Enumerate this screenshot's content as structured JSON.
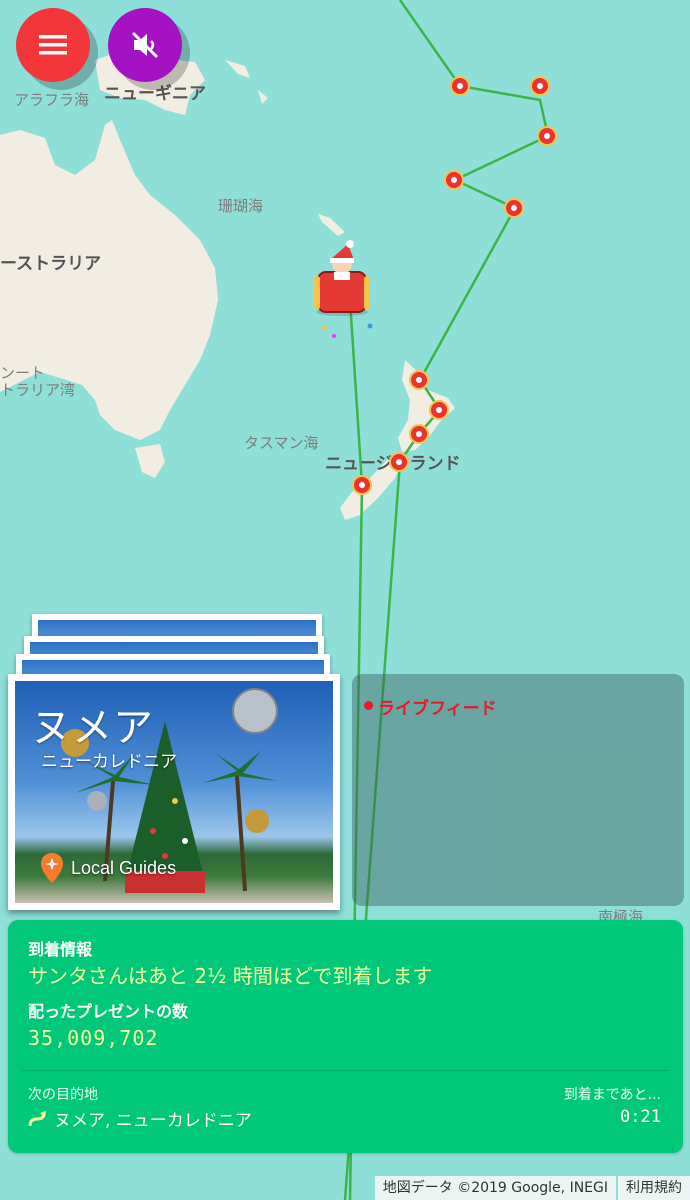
{
  "map": {
    "labels": {
      "arafura": "アラフラ海",
      "new_guinea": "ニューギニア",
      "coral_sea": "珊瑚海",
      "australia": "ーストラリア",
      "gulf_a": "ンート",
      "gulf_b": "トラリア湾",
      "tasman": "タスマン海",
      "new_zealand": "ニュージーランド",
      "southern_ocean": "南極海"
    }
  },
  "buttons": {
    "menu_icon": "menu-icon",
    "mute_icon": "volume-off-icon"
  },
  "photo_card": {
    "title": "ヌメア",
    "subtitle": "ニューカレドニア",
    "badge": "Local Guides"
  },
  "live_feed": {
    "title": "ライブフィード"
  },
  "info_panel": {
    "arrival_label": "到着情報",
    "arrival_text": "サンタさんはあと 2½ 時間ほどで到着します",
    "presents_label": "配ったプレゼントの数",
    "presents_count": "35,009,702",
    "next_label": "次の目的地",
    "next_destination": "ヌメア, ニューカレドニア",
    "eta_label": "到着まであと...",
    "eta_value": "0:21"
  },
  "footer": {
    "map_data": "地図データ ©2019 Google, INEGI",
    "terms": "利用規約"
  },
  "colors": {
    "sea": "#8fdfd9",
    "land": "#f1ede3",
    "route": "#3bb54a",
    "menu_button": "#f2363a",
    "mute_button": "#a512c4",
    "info_panel": "#00c878",
    "live_feed": "#e8192c"
  }
}
